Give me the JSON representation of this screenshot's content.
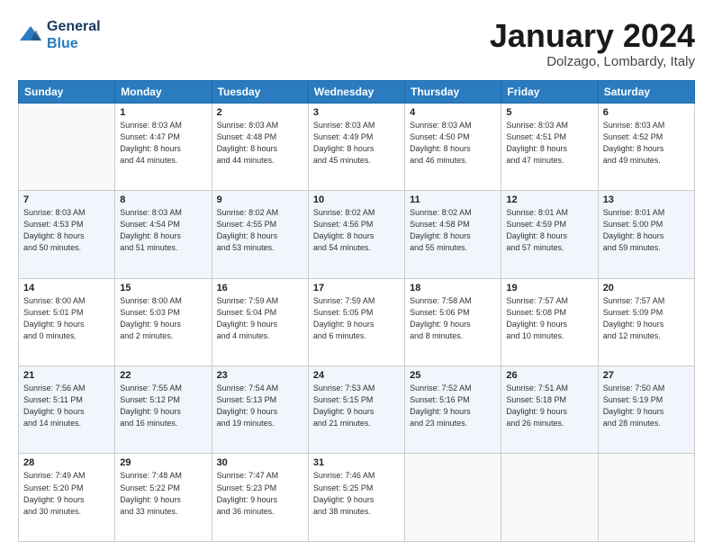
{
  "header": {
    "logo_line1": "General",
    "logo_line2": "Blue",
    "month": "January 2024",
    "location": "Dolzago, Lombardy, Italy"
  },
  "weekdays": [
    "Sunday",
    "Monday",
    "Tuesday",
    "Wednesday",
    "Thursday",
    "Friday",
    "Saturday"
  ],
  "weeks": [
    [
      {
        "day": "",
        "info": ""
      },
      {
        "day": "1",
        "info": "Sunrise: 8:03 AM\nSunset: 4:47 PM\nDaylight: 8 hours\nand 44 minutes."
      },
      {
        "day": "2",
        "info": "Sunrise: 8:03 AM\nSunset: 4:48 PM\nDaylight: 8 hours\nand 44 minutes."
      },
      {
        "day": "3",
        "info": "Sunrise: 8:03 AM\nSunset: 4:49 PM\nDaylight: 8 hours\nand 45 minutes."
      },
      {
        "day": "4",
        "info": "Sunrise: 8:03 AM\nSunset: 4:50 PM\nDaylight: 8 hours\nand 46 minutes."
      },
      {
        "day": "5",
        "info": "Sunrise: 8:03 AM\nSunset: 4:51 PM\nDaylight: 8 hours\nand 47 minutes."
      },
      {
        "day": "6",
        "info": "Sunrise: 8:03 AM\nSunset: 4:52 PM\nDaylight: 8 hours\nand 49 minutes."
      }
    ],
    [
      {
        "day": "7",
        "info": "Sunrise: 8:03 AM\nSunset: 4:53 PM\nDaylight: 8 hours\nand 50 minutes."
      },
      {
        "day": "8",
        "info": "Sunrise: 8:03 AM\nSunset: 4:54 PM\nDaylight: 8 hours\nand 51 minutes."
      },
      {
        "day": "9",
        "info": "Sunrise: 8:02 AM\nSunset: 4:55 PM\nDaylight: 8 hours\nand 53 minutes."
      },
      {
        "day": "10",
        "info": "Sunrise: 8:02 AM\nSunset: 4:56 PM\nDaylight: 8 hours\nand 54 minutes."
      },
      {
        "day": "11",
        "info": "Sunrise: 8:02 AM\nSunset: 4:58 PM\nDaylight: 8 hours\nand 55 minutes."
      },
      {
        "day": "12",
        "info": "Sunrise: 8:01 AM\nSunset: 4:59 PM\nDaylight: 8 hours\nand 57 minutes."
      },
      {
        "day": "13",
        "info": "Sunrise: 8:01 AM\nSunset: 5:00 PM\nDaylight: 8 hours\nand 59 minutes."
      }
    ],
    [
      {
        "day": "14",
        "info": "Sunrise: 8:00 AM\nSunset: 5:01 PM\nDaylight: 9 hours\nand 0 minutes."
      },
      {
        "day": "15",
        "info": "Sunrise: 8:00 AM\nSunset: 5:03 PM\nDaylight: 9 hours\nand 2 minutes."
      },
      {
        "day": "16",
        "info": "Sunrise: 7:59 AM\nSunset: 5:04 PM\nDaylight: 9 hours\nand 4 minutes."
      },
      {
        "day": "17",
        "info": "Sunrise: 7:59 AM\nSunset: 5:05 PM\nDaylight: 9 hours\nand 6 minutes."
      },
      {
        "day": "18",
        "info": "Sunrise: 7:58 AM\nSunset: 5:06 PM\nDaylight: 9 hours\nand 8 minutes."
      },
      {
        "day": "19",
        "info": "Sunrise: 7:57 AM\nSunset: 5:08 PM\nDaylight: 9 hours\nand 10 minutes."
      },
      {
        "day": "20",
        "info": "Sunrise: 7:57 AM\nSunset: 5:09 PM\nDaylight: 9 hours\nand 12 minutes."
      }
    ],
    [
      {
        "day": "21",
        "info": "Sunrise: 7:56 AM\nSunset: 5:11 PM\nDaylight: 9 hours\nand 14 minutes."
      },
      {
        "day": "22",
        "info": "Sunrise: 7:55 AM\nSunset: 5:12 PM\nDaylight: 9 hours\nand 16 minutes."
      },
      {
        "day": "23",
        "info": "Sunrise: 7:54 AM\nSunset: 5:13 PM\nDaylight: 9 hours\nand 19 minutes."
      },
      {
        "day": "24",
        "info": "Sunrise: 7:53 AM\nSunset: 5:15 PM\nDaylight: 9 hours\nand 21 minutes."
      },
      {
        "day": "25",
        "info": "Sunrise: 7:52 AM\nSunset: 5:16 PM\nDaylight: 9 hours\nand 23 minutes."
      },
      {
        "day": "26",
        "info": "Sunrise: 7:51 AM\nSunset: 5:18 PM\nDaylight: 9 hours\nand 26 minutes."
      },
      {
        "day": "27",
        "info": "Sunrise: 7:50 AM\nSunset: 5:19 PM\nDaylight: 9 hours\nand 28 minutes."
      }
    ],
    [
      {
        "day": "28",
        "info": "Sunrise: 7:49 AM\nSunset: 5:20 PM\nDaylight: 9 hours\nand 30 minutes."
      },
      {
        "day": "29",
        "info": "Sunrise: 7:48 AM\nSunset: 5:22 PM\nDaylight: 9 hours\nand 33 minutes."
      },
      {
        "day": "30",
        "info": "Sunrise: 7:47 AM\nSunset: 5:23 PM\nDaylight: 9 hours\nand 36 minutes."
      },
      {
        "day": "31",
        "info": "Sunrise: 7:46 AM\nSunset: 5:25 PM\nDaylight: 9 hours\nand 38 minutes."
      },
      {
        "day": "",
        "info": ""
      },
      {
        "day": "",
        "info": ""
      },
      {
        "day": "",
        "info": ""
      }
    ]
  ]
}
